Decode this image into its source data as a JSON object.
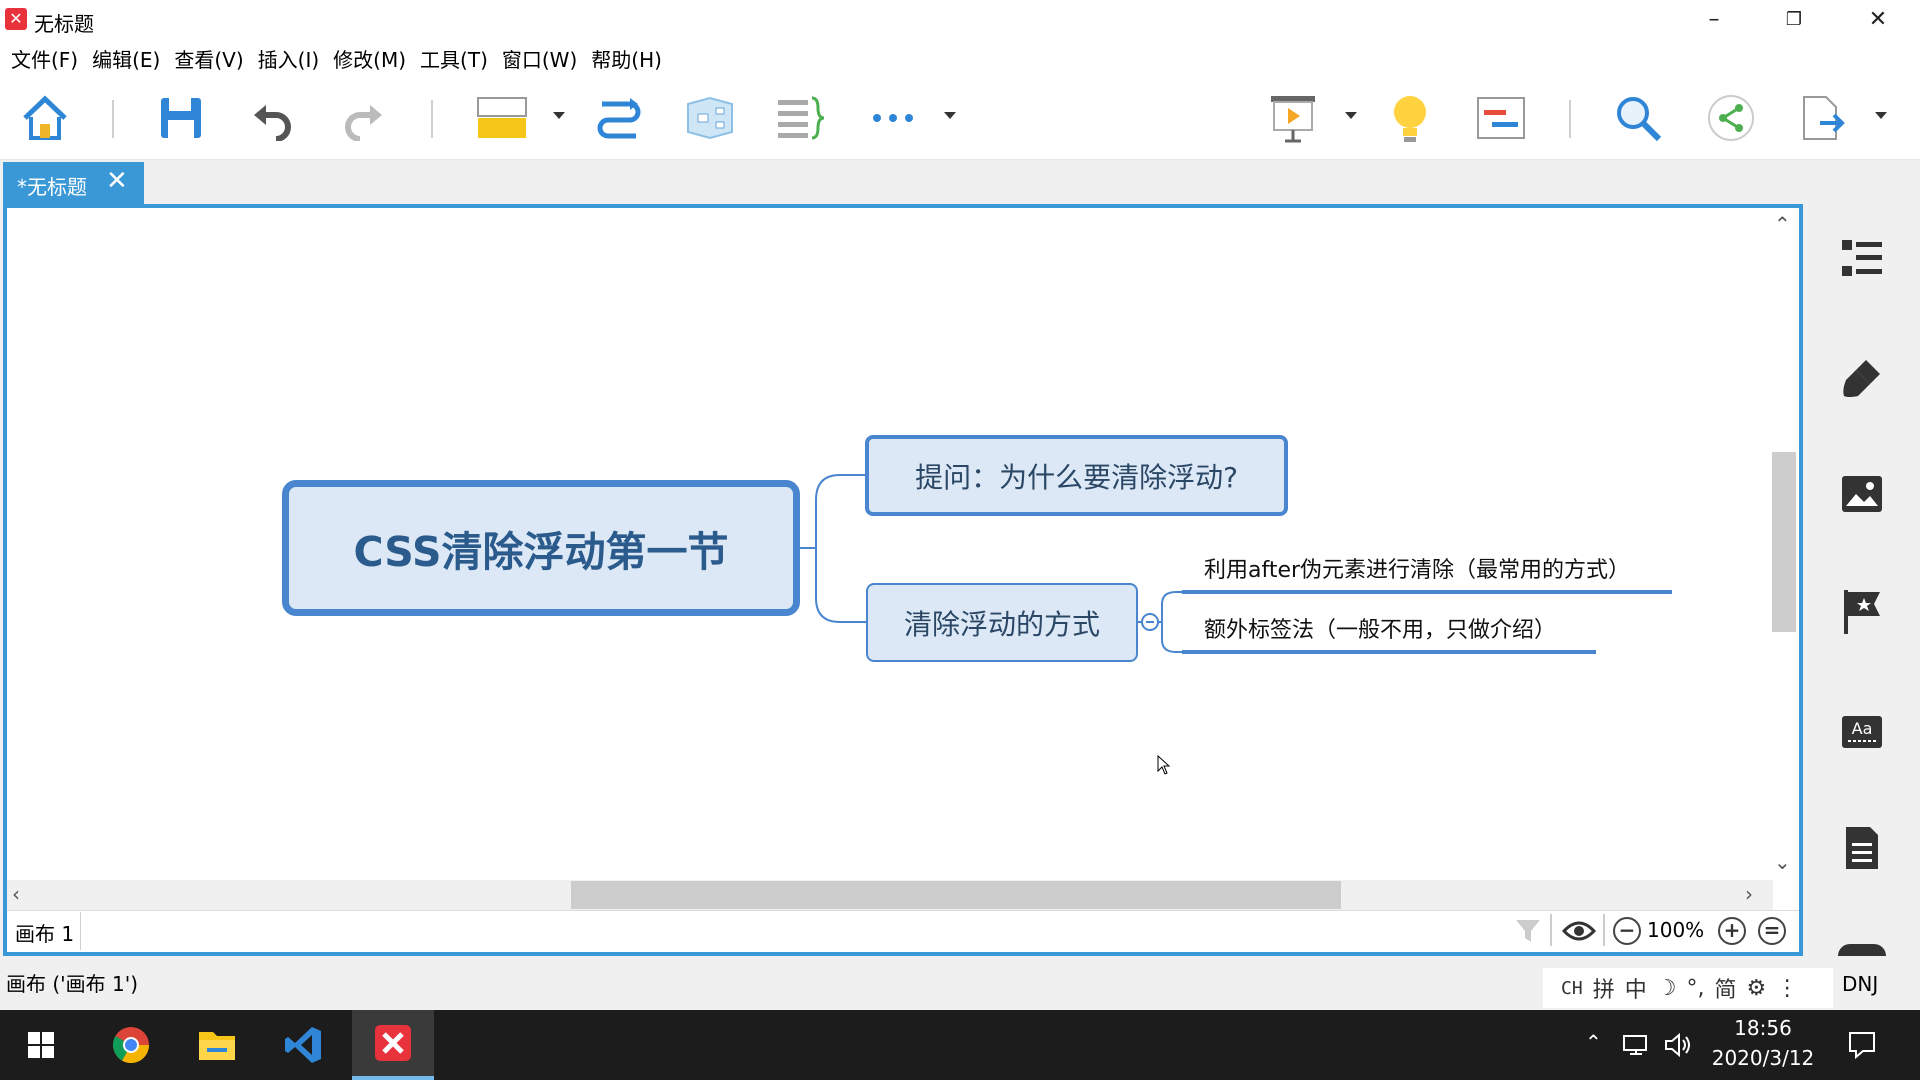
{
  "window": {
    "title": "无标题",
    "app_icon": "xmind-icon"
  },
  "menu": [
    "文件(F)",
    "编辑(E)",
    "查看(V)",
    "插入(I)",
    "修改(M)",
    "工具(T)",
    "窗口(W)",
    "帮助(H)"
  ],
  "document_tab": {
    "label": "*无标题",
    "close": "✕"
  },
  "mindmap": {
    "central_topic": "CSS清除浮动第一节",
    "topics": [
      {
        "label": "提问：为什么要清除浮动?"
      },
      {
        "label": "清除浮动的方式",
        "subtopics": [
          "利用after伪元素进行清除（最常用的方式）",
          "额外标签法（一般不用，只做介绍）"
        ]
      }
    ]
  },
  "sheet": {
    "tab_label": "画布 1"
  },
  "zoom": {
    "level": "100%",
    "minus": "−",
    "plus": "+",
    "fit": "="
  },
  "statusbar": {
    "text": "画布 ('画布 1')"
  },
  "ime": {
    "items": [
      "CH",
      "拼",
      "中",
      "☽",
      "°,",
      "简",
      "⚙",
      "⋮"
    ],
    "extra": "DNJ"
  },
  "taskbar": {
    "time": "18:56",
    "date": "2020/3/12"
  },
  "colors": {
    "accent": "#3a98d6",
    "node_fill": "#dce8f5",
    "node_border": "#4a86cf",
    "connector": "#4a86cf"
  }
}
